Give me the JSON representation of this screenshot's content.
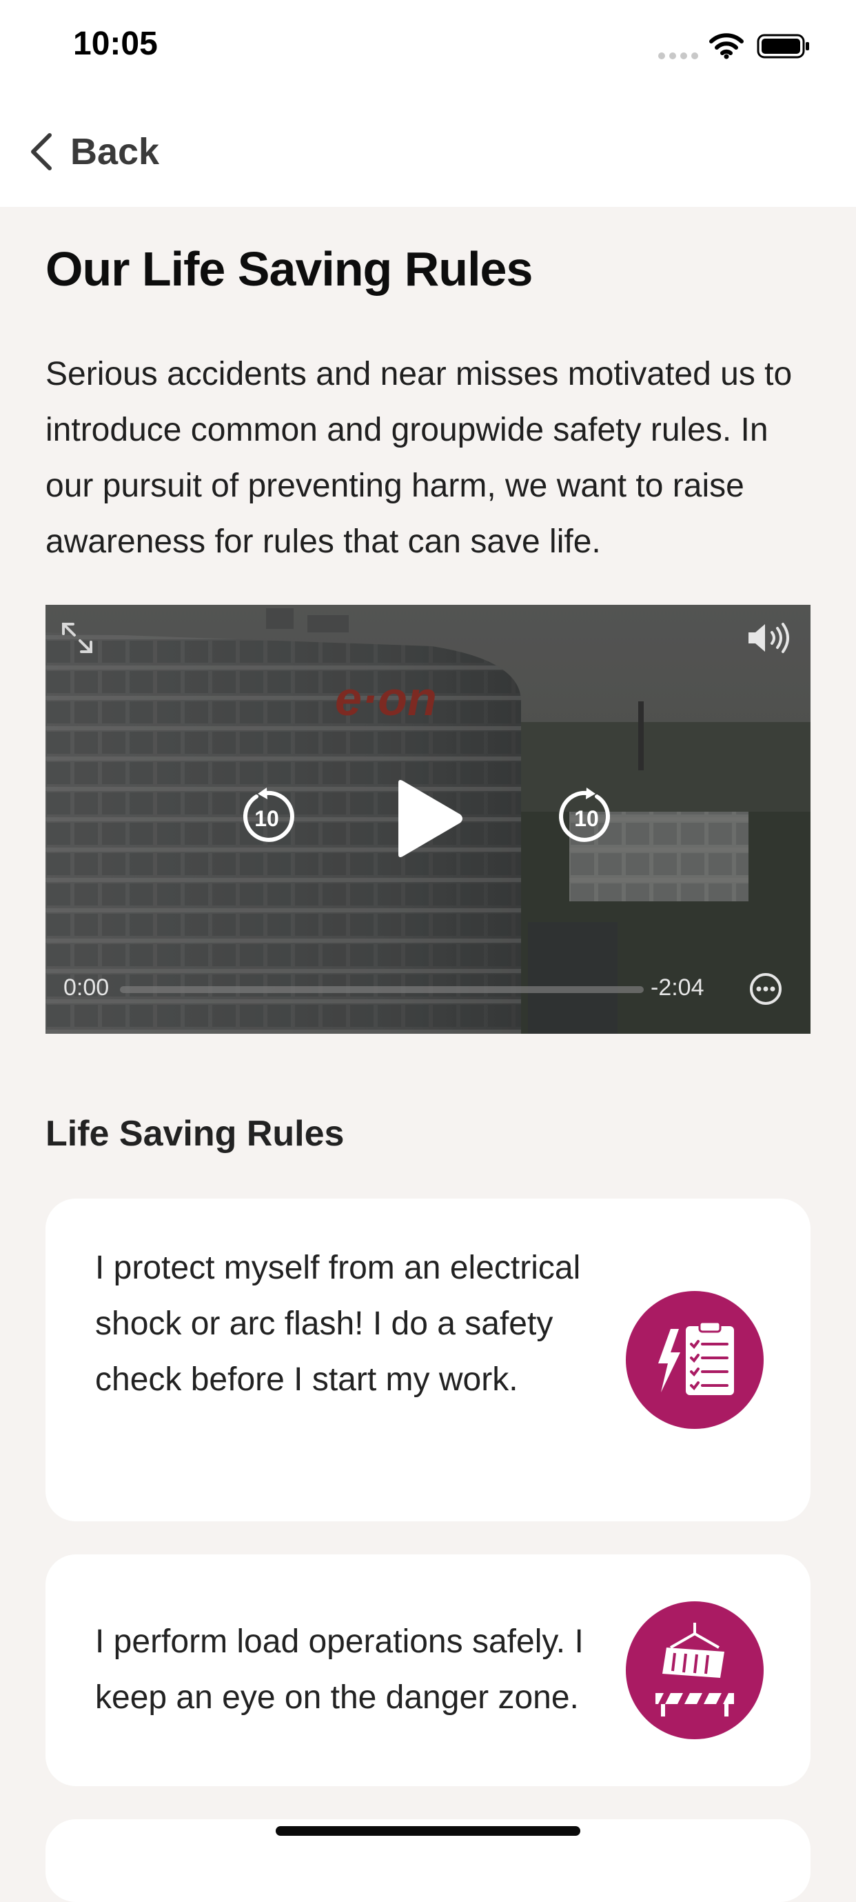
{
  "status_bar": {
    "time": "10:05"
  },
  "nav": {
    "back_label": "Back"
  },
  "page": {
    "title": "Our Life Saving Rules",
    "intro": "Serious accidents and near misses motivated us to introduce common and groupwide safety rules. In our pursuit of preventing harm, we want to raise awareness for rules that can save life."
  },
  "video": {
    "logo_text": "e·on",
    "skip_seconds": "10",
    "elapsed": "0:00",
    "remaining": "-2:04",
    "progress": 0.0
  },
  "rules_section": {
    "title": "Life Saving Rules",
    "rules": [
      {
        "text": "I protect myself from an electrical shock or arc flash! I do a safety check before I start my work.",
        "icon": "electrical-checklist-icon"
      },
      {
        "text": "I perform load operations safely. I keep an eye on the danger zone.",
        "icon": "suspended-load-icon"
      }
    ]
  },
  "colors": {
    "accent": "#aa1b63",
    "background": "#f6f3f1",
    "card": "#ffffff"
  }
}
